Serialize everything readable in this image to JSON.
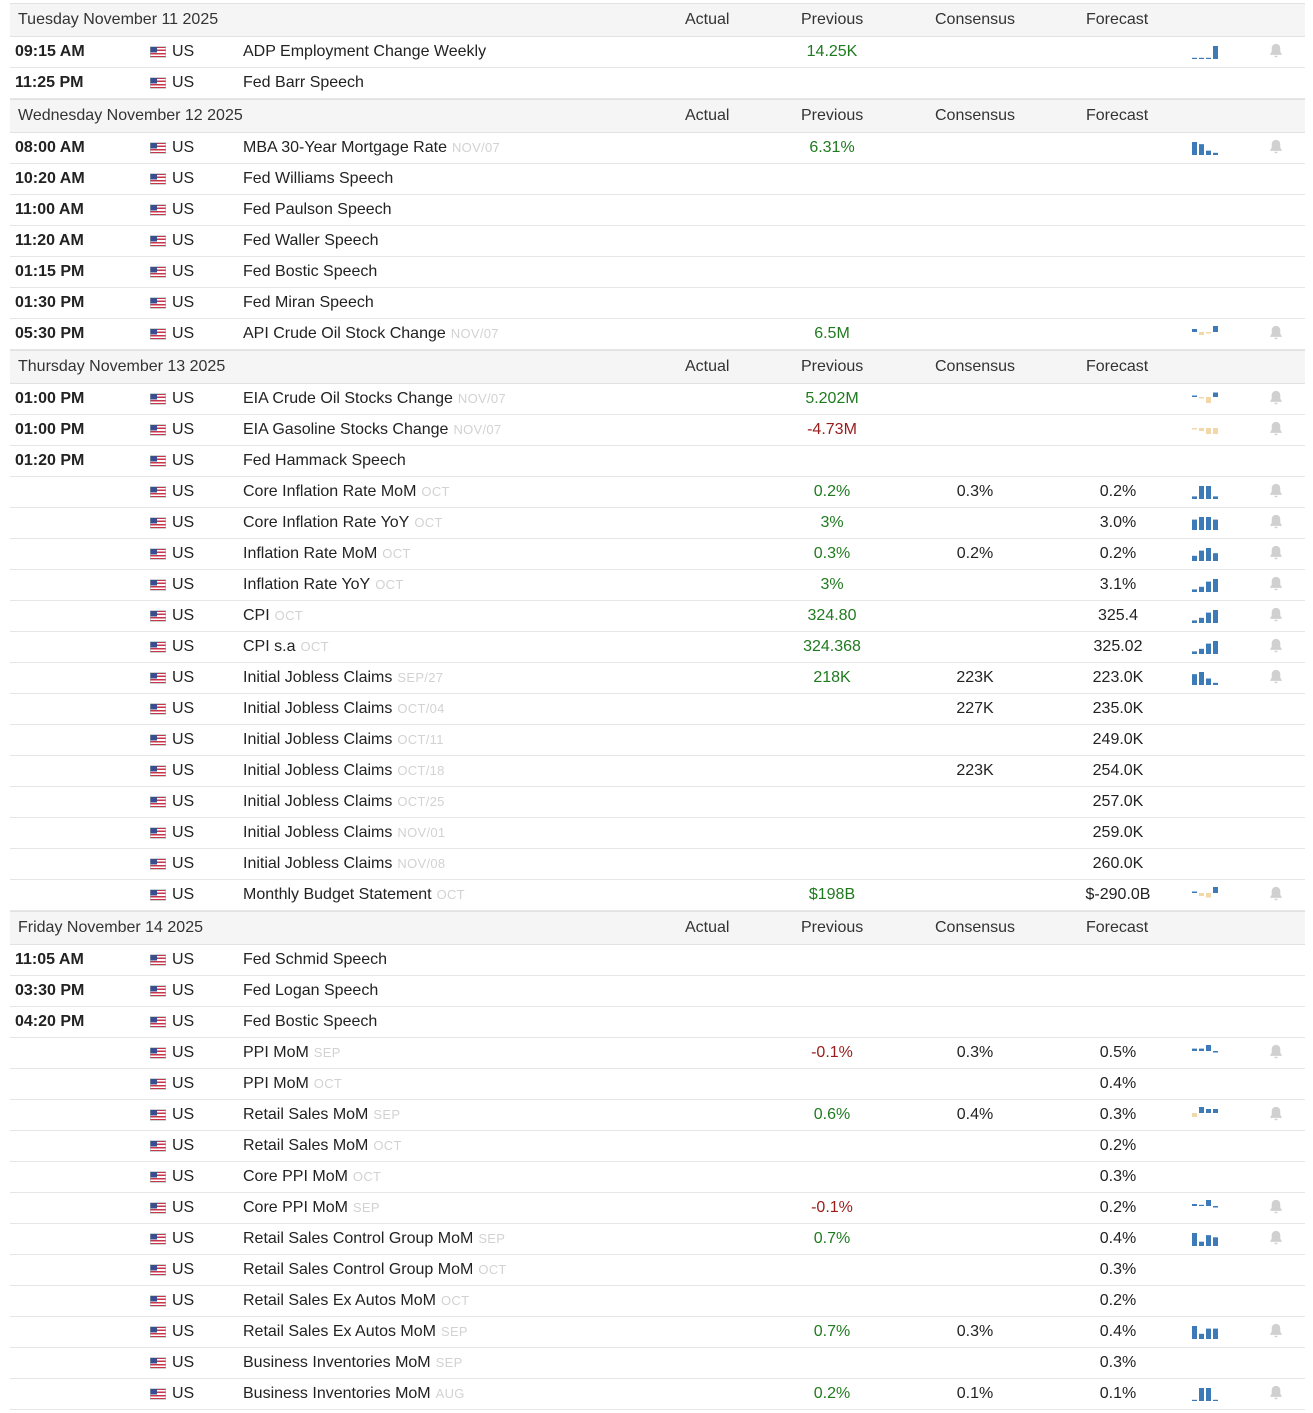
{
  "columns": {
    "actual": "Actual",
    "previous": "Previous",
    "consensus": "Consensus",
    "forecast": "Forecast"
  },
  "colors": {
    "positive": "#1f7a1f",
    "negative": "#9b1a1a",
    "spark_blue": "#3d7ab8",
    "spark_tan": "#f2d8a8",
    "bell": "#d0d0d0"
  },
  "sections": [
    {
      "day": "Tuesday November 11 2025",
      "rows": [
        {
          "time": "09:15 AM",
          "country": "US",
          "event": "ADP Employment Change Weekly",
          "ref": "",
          "previous": "14.25K",
          "prev_tone": "pos",
          "consensus": "",
          "forecast": "",
          "spark": [
            0,
            0,
            0,
            1
          ],
          "spark_tone": "blue",
          "bell": true
        },
        {
          "time": "11:25 PM",
          "country": "US",
          "event": "Fed Barr Speech",
          "ref": "",
          "previous": "",
          "prev_tone": "",
          "consensus": "",
          "forecast": "",
          "spark": null,
          "bell": false
        }
      ]
    },
    {
      "day": "Wednesday November 12 2025",
      "rows": [
        {
          "time": "08:00 AM",
          "country": "US",
          "event": "MBA 30-Year Mortgage Rate",
          "ref": "NOV/07",
          "previous": "6.31%",
          "prev_tone": "pos",
          "consensus": "",
          "forecast": "",
          "spark": [
            6,
            5,
            2,
            1
          ],
          "spark_tone": "blue",
          "bell": true
        },
        {
          "time": "10:20 AM",
          "country": "US",
          "event": "Fed Williams Speech",
          "ref": "",
          "previous": "",
          "prev_tone": "",
          "consensus": "",
          "forecast": "",
          "spark": null,
          "bell": false
        },
        {
          "time": "11:00 AM",
          "country": "US",
          "event": "Fed Paulson Speech",
          "ref": "",
          "previous": "",
          "prev_tone": "",
          "consensus": "",
          "forecast": "",
          "spark": null,
          "bell": false
        },
        {
          "time": "11:20 AM",
          "country": "US",
          "event": "Fed Waller Speech",
          "ref": "",
          "previous": "",
          "prev_tone": "",
          "consensus": "",
          "forecast": "",
          "spark": null,
          "bell": false
        },
        {
          "time": "01:15 PM",
          "country": "US",
          "event": "Fed Bostic Speech",
          "ref": "",
          "previous": "",
          "prev_tone": "",
          "consensus": "",
          "forecast": "",
          "spark": null,
          "bell": false
        },
        {
          "time": "01:30 PM",
          "country": "US",
          "event": "Fed Miran Speech",
          "ref": "",
          "previous": "",
          "prev_tone": "",
          "consensus": "",
          "forecast": "",
          "spark": null,
          "bell": false
        },
        {
          "time": "05:30 PM",
          "country": "US",
          "event": "API Crude Oil Stock Change",
          "ref": "NOV/07",
          "previous": "6.5M",
          "prev_tone": "pos",
          "consensus": "",
          "forecast": "",
          "spark": [
            2,
            -2,
            -1,
            4
          ],
          "spark_tone": "mixed",
          "bell": true
        }
      ]
    },
    {
      "day": "Thursday November 13 2025",
      "rows": [
        {
          "time": "01:00 PM",
          "country": "US",
          "event": "EIA Crude Oil Stocks Change",
          "ref": "NOV/07",
          "previous": "5.202M",
          "prev_tone": "pos",
          "consensus": "",
          "forecast": "",
          "spark": [
            1,
            -1,
            -4,
            3
          ],
          "spark_tone": "mixed",
          "bell": true
        },
        {
          "time": "01:00 PM",
          "country": "US",
          "event": "EIA Gasoline Stocks Change",
          "ref": "NOV/07",
          "previous": "-4.73M",
          "prev_tone": "neg",
          "consensus": "",
          "forecast": "",
          "spark": [
            -1,
            -3,
            -6,
            -6
          ],
          "spark_tone": "tan",
          "bell": true
        },
        {
          "time": "01:20 PM",
          "country": "US",
          "event": "Fed Hammack Speech",
          "ref": "",
          "previous": "",
          "prev_tone": "",
          "consensus": "",
          "forecast": "",
          "spark": null,
          "bell": false
        },
        {
          "time": "",
          "country": "US",
          "event": "Core Inflation Rate MoM",
          "ref": "OCT",
          "previous": "0.2%",
          "prev_tone": "pos",
          "consensus": "0.3%",
          "forecast": "0.2%",
          "spark": [
            1,
            5,
            5,
            1
          ],
          "spark_tone": "blue",
          "bell": true
        },
        {
          "time": "",
          "country": "US",
          "event": "Core Inflation Rate YoY",
          "ref": "OCT",
          "previous": "3%",
          "prev_tone": "pos",
          "consensus": "",
          "forecast": "3.0%",
          "spark": [
            4,
            5,
            5,
            4
          ],
          "spark_tone": "blue",
          "bell": true
        },
        {
          "time": "",
          "country": "US",
          "event": "Inflation Rate MoM",
          "ref": "OCT",
          "previous": "0.3%",
          "prev_tone": "pos",
          "consensus": "0.2%",
          "forecast": "0.2%",
          "spark": [
            2,
            4,
            5,
            3
          ],
          "spark_tone": "blue",
          "bell": true
        },
        {
          "time": "",
          "country": "US",
          "event": "Inflation Rate YoY",
          "ref": "OCT",
          "previous": "3%",
          "prev_tone": "pos",
          "consensus": "",
          "forecast": "3.1%",
          "spark": [
            1,
            2,
            4,
            5
          ],
          "spark_tone": "blue",
          "bell": true
        },
        {
          "time": "",
          "country": "US",
          "event": "CPI",
          "ref": "OCT",
          "previous": "324.80",
          "prev_tone": "pos",
          "consensus": "",
          "forecast": "325.4",
          "spark": [
            1,
            2,
            4,
            5
          ],
          "spark_tone": "blue",
          "bell": true
        },
        {
          "time": "",
          "country": "US",
          "event": "CPI s.a",
          "ref": "OCT",
          "previous": "324.368",
          "prev_tone": "pos",
          "consensus": "",
          "forecast": "325.02",
          "spark": [
            1,
            2,
            4,
            5
          ],
          "spark_tone": "blue",
          "bell": true
        },
        {
          "time": "",
          "country": "US",
          "event": "Initial Jobless Claims",
          "ref": "SEP/27",
          "previous": "218K",
          "prev_tone": "pos",
          "consensus": "223K",
          "forecast": "223.0K",
          "spark": [
            5,
            6,
            3,
            1
          ],
          "spark_tone": "blue",
          "bell": true
        },
        {
          "time": "",
          "country": "US",
          "event": "Initial Jobless Claims",
          "ref": "OCT/04",
          "previous": "",
          "prev_tone": "",
          "consensus": "227K",
          "forecast": "235.0K",
          "spark": null,
          "bell": false
        },
        {
          "time": "",
          "country": "US",
          "event": "Initial Jobless Claims",
          "ref": "OCT/11",
          "previous": "",
          "prev_tone": "",
          "consensus": "",
          "forecast": "249.0K",
          "spark": null,
          "bell": false
        },
        {
          "time": "",
          "country": "US",
          "event": "Initial Jobless Claims",
          "ref": "OCT/18",
          "previous": "",
          "prev_tone": "",
          "consensus": "223K",
          "forecast": "254.0K",
          "spark": null,
          "bell": false
        },
        {
          "time": "",
          "country": "US",
          "event": "Initial Jobless Claims",
          "ref": "OCT/25",
          "previous": "",
          "prev_tone": "",
          "consensus": "",
          "forecast": "257.0K",
          "spark": null,
          "bell": false
        },
        {
          "time": "",
          "country": "US",
          "event": "Initial Jobless Claims",
          "ref": "NOV/01",
          "previous": "",
          "prev_tone": "",
          "consensus": "",
          "forecast": "259.0K",
          "spark": null,
          "bell": false
        },
        {
          "time": "",
          "country": "US",
          "event": "Initial Jobless Claims",
          "ref": "NOV/08",
          "previous": "",
          "prev_tone": "",
          "consensus": "",
          "forecast": "260.0K",
          "spark": null,
          "bell": false
        },
        {
          "time": "",
          "country": "US",
          "event": "Monthly Budget Statement",
          "ref": "OCT",
          "previous": "$198B",
          "prev_tone": "pos",
          "consensus": "",
          "forecast": "$-290.0B",
          "spark": [
            1,
            -2,
            -3,
            4
          ],
          "spark_tone": "mixed",
          "bell": true
        }
      ]
    },
    {
      "day": "Friday November 14 2025",
      "rows": [
        {
          "time": "11:05 AM",
          "country": "US",
          "event": "Fed Schmid Speech",
          "ref": "",
          "previous": "",
          "prev_tone": "",
          "consensus": "",
          "forecast": "",
          "spark": null,
          "bell": false
        },
        {
          "time": "03:30 PM",
          "country": "US",
          "event": "Fed Logan Speech",
          "ref": "",
          "previous": "",
          "prev_tone": "",
          "consensus": "",
          "forecast": "",
          "spark": null,
          "bell": false
        },
        {
          "time": "04:20 PM",
          "country": "US",
          "event": "Fed Bostic Speech",
          "ref": "",
          "previous": "",
          "prev_tone": "",
          "consensus": "",
          "forecast": "",
          "spark": null,
          "bell": false
        },
        {
          "time": "",
          "country": "US",
          "event": "PPI MoM",
          "ref": "SEP",
          "previous": "-0.1%",
          "prev_tone": "neg",
          "consensus": "0.3%",
          "forecast": "0.5%",
          "spark": [
            2,
            2,
            5,
            -1
          ],
          "spark_tone": "blue",
          "bell": true
        },
        {
          "time": "",
          "country": "US",
          "event": "PPI MoM",
          "ref": "OCT",
          "previous": "",
          "prev_tone": "",
          "consensus": "",
          "forecast": "0.4%",
          "spark": null,
          "bell": false
        },
        {
          "time": "",
          "country": "US",
          "event": "Retail Sales MoM",
          "ref": "SEP",
          "previous": "0.6%",
          "prev_tone": "pos",
          "consensus": "0.4%",
          "forecast": "0.3%",
          "spark": [
            -2,
            3,
            2,
            2
          ],
          "spark_tone": "mixed",
          "bell": true
        },
        {
          "time": "",
          "country": "US",
          "event": "Retail Sales MoM",
          "ref": "OCT",
          "previous": "",
          "prev_tone": "",
          "consensus": "",
          "forecast": "0.2%",
          "spark": null,
          "bell": false
        },
        {
          "time": "",
          "country": "US",
          "event": "Core PPI MoM",
          "ref": "OCT",
          "previous": "",
          "prev_tone": "",
          "consensus": "",
          "forecast": "0.3%",
          "spark": null,
          "bell": false
        },
        {
          "time": "",
          "country": "US",
          "event": "Core PPI MoM",
          "ref": "SEP",
          "previous": "-0.1%",
          "prev_tone": "neg",
          "consensus": "",
          "forecast": "0.2%",
          "spark": [
            2,
            0,
            6,
            -1
          ],
          "spark_tone": "blue",
          "bell": true
        },
        {
          "time": "",
          "country": "US",
          "event": "Retail Sales Control Group MoM",
          "ref": "SEP",
          "previous": "0.7%",
          "prev_tone": "pos",
          "consensus": "",
          "forecast": "0.4%",
          "spark": [
            6,
            2,
            5,
            4
          ],
          "spark_tone": "blue",
          "bell": true
        },
        {
          "time": "",
          "country": "US",
          "event": "Retail Sales Control Group MoM",
          "ref": "OCT",
          "previous": "",
          "prev_tone": "",
          "consensus": "",
          "forecast": "0.3%",
          "spark": null,
          "bell": false
        },
        {
          "time": "",
          "country": "US",
          "event": "Retail Sales Ex Autos MoM",
          "ref": "OCT",
          "previous": "",
          "prev_tone": "",
          "consensus": "",
          "forecast": "0.2%",
          "spark": null,
          "bell": false
        },
        {
          "time": "",
          "country": "US",
          "event": "Retail Sales Ex Autos MoM",
          "ref": "SEP",
          "previous": "0.7%",
          "prev_tone": "pos",
          "consensus": "0.3%",
          "forecast": "0.4%",
          "spark": [
            5,
            2,
            4,
            4
          ],
          "spark_tone": "blue",
          "bell": true
        },
        {
          "time": "",
          "country": "US",
          "event": "Business Inventories MoM",
          "ref": "SEP",
          "previous": "",
          "prev_tone": "",
          "consensus": "",
          "forecast": "0.3%",
          "spark": null,
          "bell": false
        },
        {
          "time": "",
          "country": "US",
          "event": "Business Inventories MoM",
          "ref": "AUG",
          "previous": "0.2%",
          "prev_tone": "pos",
          "consensus": "0.1%",
          "forecast": "0.1%",
          "spark": [
            0,
            5,
            5,
            0
          ],
          "spark_tone": "blue",
          "bell": true
        }
      ]
    }
  ]
}
